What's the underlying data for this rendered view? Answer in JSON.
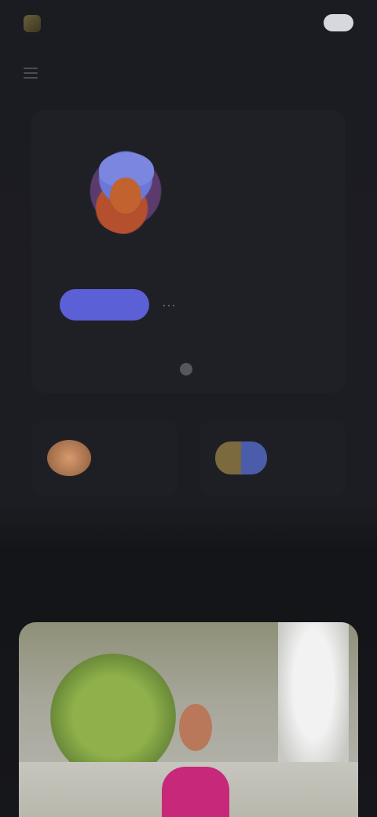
{
  "header": {
    "logo_text": "",
    "link_label": "",
    "pill_label": ""
  },
  "profile": {
    "username": "",
    "follow_label": "",
    "more_label": "···",
    "stats": [
      {
        "value": "",
        "label": ""
      },
      {
        "value": "",
        "label": ""
      },
      {
        "value": "",
        "label": ""
      }
    ],
    "share_label": ""
  },
  "badges": [
    {
      "label": "",
      "icon": "coin-icon"
    },
    {
      "label": "",
      "icon": "group-icon"
    }
  ],
  "colors": {
    "background": "#1b1c21",
    "card": "#1f2025",
    "accent": "#5b60d6"
  }
}
